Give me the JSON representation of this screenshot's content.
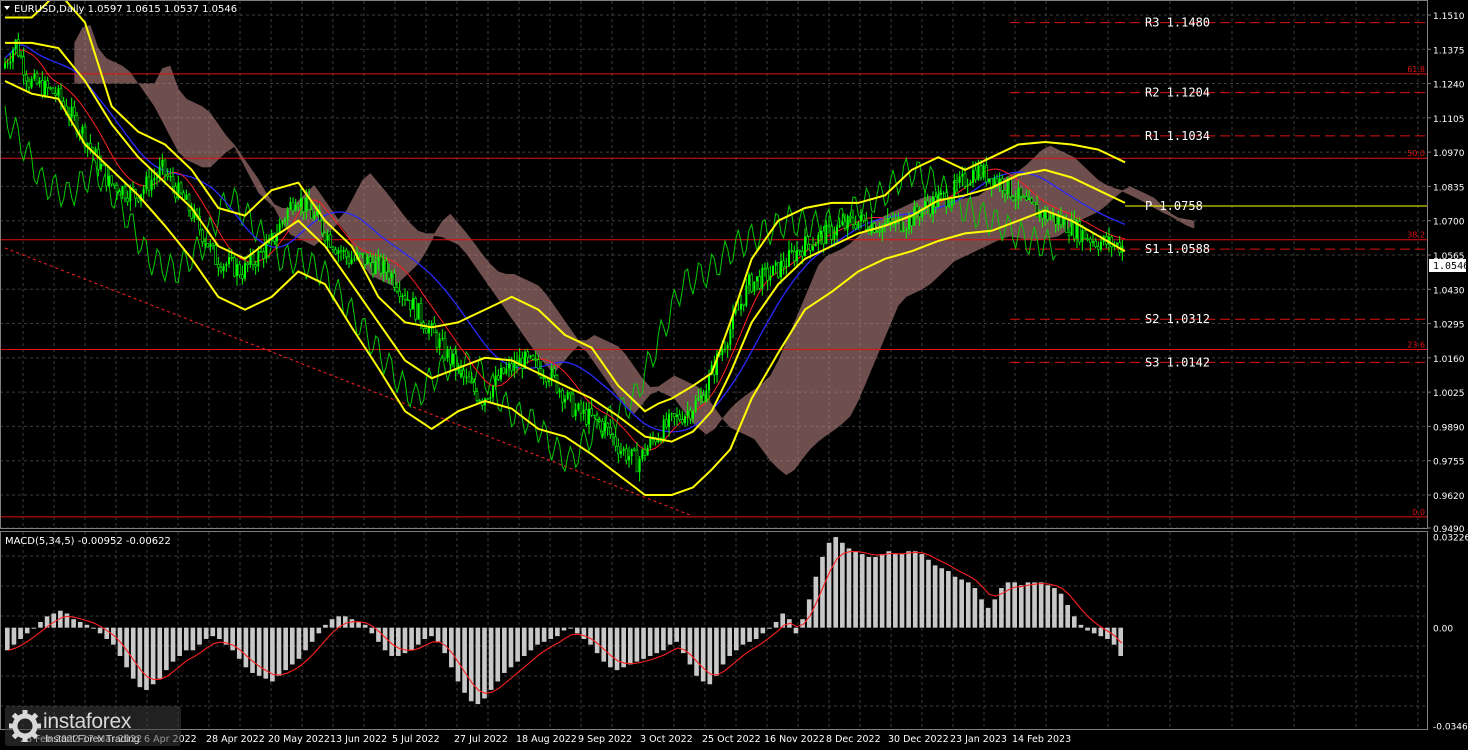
{
  "symbol_info": "EURUSD,Daily  1.0597 1.0615 1.0537 1.0546",
  "macd_info": "MACD(5,34,5) -0.00952 -0.00622",
  "last_price": "1.0546",
  "colors": {
    "background": "#000000",
    "grid": "#3c3c3c",
    "bull_candle": "#00ff00",
    "bollinger": "#ffff00",
    "fib": "#ff2020",
    "pivot": "#ff2020",
    "kijun": "#0000ff",
    "tenkan": "#ff0000",
    "chikou": "#00cc00",
    "macd_hist": "#c0c0c0",
    "macd_signal": "#ff0000",
    "price_box": "#ffffff"
  },
  "watermark": {
    "brand": "instaforex",
    "tagline": "Instant Forex Trading",
    "icon": "gear-logo-icon"
  },
  "chart_data": [
    {
      "type": "line",
      "title": "EURUSD,Daily",
      "y_ticks": [
        "1.1510",
        "1.1375",
        "1.1240",
        "1.1105",
        "1.0970",
        "1.0835",
        "1.0700",
        "1.0565",
        "1.0430",
        "1.0295",
        "1.0160",
        "1.0025",
        "0.9890",
        "0.9755",
        "0.9620",
        "0.9490"
      ],
      "ylim": [
        0.949,
        1.1565
      ],
      "x_ticks": [
        "28 Feb 2022",
        "17 Mar 2022",
        "6 Apr 2022",
        "28 Apr 2022",
        "20 May 2022",
        "13 Jun 2022",
        "5 Jul 2022",
        "27 Jul 2022",
        "18 Aug 2022",
        "9 Sep 2022",
        "3 Oct 2022",
        "25 Oct 2022",
        "16 Nov 2022",
        "8 Dec 2022",
        "30 Dec 2022",
        "23 Jan 2023",
        "14 Feb 2023"
      ],
      "fib_levels": [
        {
          "label": "61.8",
          "value": 1.1278
        },
        {
          "label": "50.0",
          "value": 1.0946
        },
        {
          "label": "38.2",
          "value": 1.0625
        },
        {
          "label": "23.6",
          "value": 1.0193
        },
        {
          "label": "0.0",
          "value": 0.9534
        }
      ],
      "pivots": [
        {
          "label": "R3  1.1480",
          "value": 1.148
        },
        {
          "label": "R2  1.1204",
          "value": 1.1204
        },
        {
          "label": "R1  1.1034",
          "value": 1.1034
        },
        {
          "label": "P  1.0758",
          "value": 1.0758
        },
        {
          "label": "S1  1.0588",
          "value": 1.0588
        },
        {
          "label": "S2  1.0312",
          "value": 1.0312
        },
        {
          "label": "S3  1.0142",
          "value": 1.0142
        }
      ],
      "series": [
        {
          "values": [
            [
              0,
              1.13
            ],
            [
              5,
              1.14
            ],
            [
              10,
              1.125
            ],
            [
              20,
              1.12
            ],
            [
              30,
              1.105
            ],
            [
              40,
              1.085
            ],
            [
              50,
              1.08
            ],
            [
              60,
              1.09
            ],
            [
              70,
              1.075
            ],
            [
              80,
              1.055
            ],
            [
              90,
              1.05
            ],
            [
              100,
              1.06
            ],
            [
              110,
              1.08
            ],
            [
              118,
              1.07
            ],
            [
              125,
              1.06
            ],
            [
              130,
              1.055
            ],
            [
              135,
              1.055
            ],
            [
              145,
              1.05
            ],
            [
              155,
              1.035
            ],
            [
              165,
              1.02
            ],
            [
              175,
              1.005
            ],
            [
              180,
              1.0
            ],
            [
              188,
              1.01
            ],
            [
              195,
              1.015
            ],
            [
              205,
              1.01
            ],
            [
              215,
              0.995
            ],
            [
              225,
              0.99
            ],
            [
              232,
              0.98
            ],
            [
              238,
              0.975
            ],
            [
              245,
              0.985
            ],
            [
              250,
              0.99
            ],
            [
              257,
              0.995
            ],
            [
              262,
              1.0
            ],
            [
              270,
              1.02
            ],
            [
              280,
              1.045
            ],
            [
              290,
              1.05
            ],
            [
              300,
              1.06
            ],
            [
              310,
              1.065
            ],
            [
              320,
              1.07
            ],
            [
              330,
              1.068
            ],
            [
              340,
              1.07
            ],
            [
              345,
              1.075
            ],
            [
              355,
              1.08
            ],
            [
              365,
              1.09
            ],
            [
              375,
              1.085
            ],
            [
              385,
              1.075
            ],
            [
              392,
              1.072
            ],
            [
              400,
              1.068
            ],
            [
              410,
              1.062
            ],
            [
              420,
              1.06
            ]
          ]
        }
      ],
      "bollinger": [
        {
          "name": "upper",
          "values": [
            [
              0,
              1.15
            ],
            [
              10,
              1.15
            ],
            [
              20,
              1.16
            ],
            [
              30,
              1.148
            ],
            [
              40,
              1.115
            ],
            [
              50,
              1.105
            ],
            [
              60,
              1.1
            ],
            [
              70,
              1.09
            ],
            [
              80,
              1.075
            ],
            [
              90,
              1.072
            ],
            [
              100,
              1.082
            ],
            [
              110,
              1.085
            ],
            [
              120,
              1.07
            ],
            [
              130,
              1.06
            ],
            [
              140,
              1.04
            ],
            [
              150,
              1.03
            ],
            [
              160,
              1.028
            ],
            [
              170,
              1.03
            ],
            [
              180,
              1.035
            ],
            [
              190,
              1.04
            ],
            [
              200,
              1.035
            ],
            [
              210,
              1.025
            ],
            [
              220,
              1.02
            ],
            [
              230,
              1.005
            ],
            [
              240,
              0.995
            ],
            [
              245,
              0.998
            ],
            [
              250,
              1.0
            ],
            [
              258,
              1.005
            ],
            [
              265,
              1.01
            ],
            [
              272,
              1.03
            ],
            [
              280,
              1.055
            ],
            [
              290,
              1.07
            ],
            [
              300,
              1.075
            ],
            [
              310,
              1.077
            ],
            [
              320,
              1.077
            ],
            [
              330,
              1.08
            ],
            [
              340,
              1.09
            ],
            [
              350,
              1.095
            ],
            [
              360,
              1.09
            ],
            [
              370,
              1.095
            ],
            [
              380,
              1.1
            ],
            [
              390,
              1.101
            ],
            [
              400,
              1.1
            ],
            [
              410,
              1.098
            ],
            [
              420,
              1.093
            ]
          ]
        },
        {
          "name": "middle",
          "values": [
            [
              0,
              1.14
            ],
            [
              10,
              1.14
            ],
            [
              20,
              1.138
            ],
            [
              30,
              1.125
            ],
            [
              40,
              1.108
            ],
            [
              50,
              1.095
            ],
            [
              60,
              1.085
            ],
            [
              70,
              1.075
            ],
            [
              80,
              1.06
            ],
            [
              90,
              1.055
            ],
            [
              100,
              1.063
            ],
            [
              110,
              1.07
            ],
            [
              120,
              1.06
            ],
            [
              130,
              1.045
            ],
            [
              140,
              1.03
            ],
            [
              150,
              1.015
            ],
            [
              160,
              1.008
            ],
            [
              170,
              1.012
            ],
            [
              180,
              1.016
            ],
            [
              190,
              1.015
            ],
            [
              200,
              1.01
            ],
            [
              210,
              1.005
            ],
            [
              220,
              1.0
            ],
            [
              230,
              0.993
            ],
            [
              240,
              0.985
            ],
            [
              250,
              0.983
            ],
            [
              258,
              0.987
            ],
            [
              265,
              0.995
            ],
            [
              272,
              1.01
            ],
            [
              280,
              1.03
            ],
            [
              290,
              1.045
            ],
            [
              300,
              1.055
            ],
            [
              310,
              1.06
            ],
            [
              320,
              1.065
            ],
            [
              330,
              1.068
            ],
            [
              340,
              1.072
            ],
            [
              350,
              1.078
            ],
            [
              360,
              1.08
            ],
            [
              370,
              1.083
            ],
            [
              380,
              1.088
            ],
            [
              390,
              1.09
            ],
            [
              400,
              1.087
            ],
            [
              410,
              1.082
            ],
            [
              420,
              1.077
            ]
          ]
        },
        {
          "name": "lower",
          "values": [
            [
              0,
              1.125
            ],
            [
              10,
              1.12
            ],
            [
              20,
              1.118
            ],
            [
              30,
              1.1
            ],
            [
              40,
              1.09
            ],
            [
              50,
              1.08
            ],
            [
              60,
              1.068
            ],
            [
              70,
              1.055
            ],
            [
              80,
              1.04
            ],
            [
              90,
              1.035
            ],
            [
              100,
              1.04
            ],
            [
              110,
              1.05
            ],
            [
              120,
              1.045
            ],
            [
              130,
              1.028
            ],
            [
              140,
              1.012
            ],
            [
              150,
              0.995
            ],
            [
              160,
              0.988
            ],
            [
              170,
              0.995
            ],
            [
              180,
              0.999
            ],
            [
              190,
              0.996
            ],
            [
              200,
              0.988
            ],
            [
              210,
              0.985
            ],
            [
              220,
              0.978
            ],
            [
              230,
              0.97
            ],
            [
              240,
              0.962
            ],
            [
              250,
              0.962
            ],
            [
              258,
              0.965
            ],
            [
              265,
              0.972
            ],
            [
              272,
              0.98
            ],
            [
              280,
              1.0
            ],
            [
              290,
              1.018
            ],
            [
              300,
              1.035
            ],
            [
              310,
              1.042
            ],
            [
              320,
              1.05
            ],
            [
              330,
              1.055
            ],
            [
              340,
              1.058
            ],
            [
              350,
              1.062
            ],
            [
              360,
              1.065
            ],
            [
              370,
              1.066
            ],
            [
              380,
              1.07
            ],
            [
              390,
              1.074
            ],
            [
              400,
              1.07
            ],
            [
              410,
              1.064
            ],
            [
              420,
              1.058
            ]
          ]
        }
      ],
      "bull_candle_color": "#00ff00"
    },
    {
      "type": "bar",
      "title": "MACD(5,34,5)",
      "y_ticks": [
        "0.03226",
        "0.00",
        "-0.03463"
      ],
      "ylim": [
        -0.0358,
        0.0338
      ],
      "values": [
        -0.008,
        -0.006,
        -0.004,
        -0.002,
        0.0,
        0.002,
        0.004,
        0.005,
        0.006,
        0.005,
        0.003,
        0.002,
        0.001,
        0.0,
        -0.002,
        -0.004,
        -0.006,
        -0.01,
        -0.014,
        -0.018,
        -0.021,
        -0.022,
        -0.02,
        -0.018,
        -0.015,
        -0.012,
        -0.01,
        -0.008,
        -0.008,
        -0.006,
        -0.004,
        -0.003,
        -0.004,
        -0.006,
        -0.008,
        -0.011,
        -0.014,
        -0.016,
        -0.017,
        -0.018,
        -0.019,
        -0.017,
        -0.015,
        -0.013,
        -0.011,
        -0.008,
        -0.005,
        -0.002,
        0.001,
        0.003,
        0.004,
        0.004,
        0.003,
        0.002,
        0.001,
        -0.002,
        -0.005,
        -0.008,
        -0.01,
        -0.01,
        -0.009,
        -0.008,
        -0.006,
        -0.004,
        -0.003,
        -0.005,
        -0.009,
        -0.014,
        -0.019,
        -0.023,
        -0.026,
        -0.027,
        -0.025,
        -0.022,
        -0.019,
        -0.016,
        -0.014,
        -0.012,
        -0.01,
        -0.008,
        -0.006,
        -0.005,
        -0.004,
        -0.003,
        -0.001,
        0.0,
        -0.002,
        -0.004,
        -0.006,
        -0.009,
        -0.012,
        -0.014,
        -0.015,
        -0.014,
        -0.013,
        -0.012,
        -0.011,
        -0.01,
        -0.009,
        -0.008,
        -0.006,
        -0.005,
        -0.009,
        -0.013,
        -0.017,
        -0.019,
        -0.02,
        -0.017,
        -0.013,
        -0.01,
        -0.008,
        -0.006,
        -0.005,
        -0.004,
        -0.002,
        0.0,
        0.002,
        0.005,
        0.003,
        -0.002,
        0.003,
        0.01,
        0.018,
        0.025,
        0.03,
        0.032,
        0.03,
        0.028,
        0.027,
        0.026,
        0.025,
        0.025,
        0.026,
        0.027,
        0.026,
        0.026,
        0.027,
        0.027,
        0.026,
        0.024,
        0.022,
        0.021,
        0.02,
        0.018,
        0.017,
        0.016,
        0.014,
        0.01,
        0.007,
        0.01,
        0.014,
        0.016,
        0.016,
        0.015,
        0.016,
        0.016,
        0.016,
        0.015,
        0.014,
        0.012,
        0.008,
        0.004,
        0.001,
        -0.001,
        -0.002,
        -0.003,
        -0.004,
        -0.006,
        -0.01
      ],
      "signal_color": "#ff0000"
    }
  ]
}
